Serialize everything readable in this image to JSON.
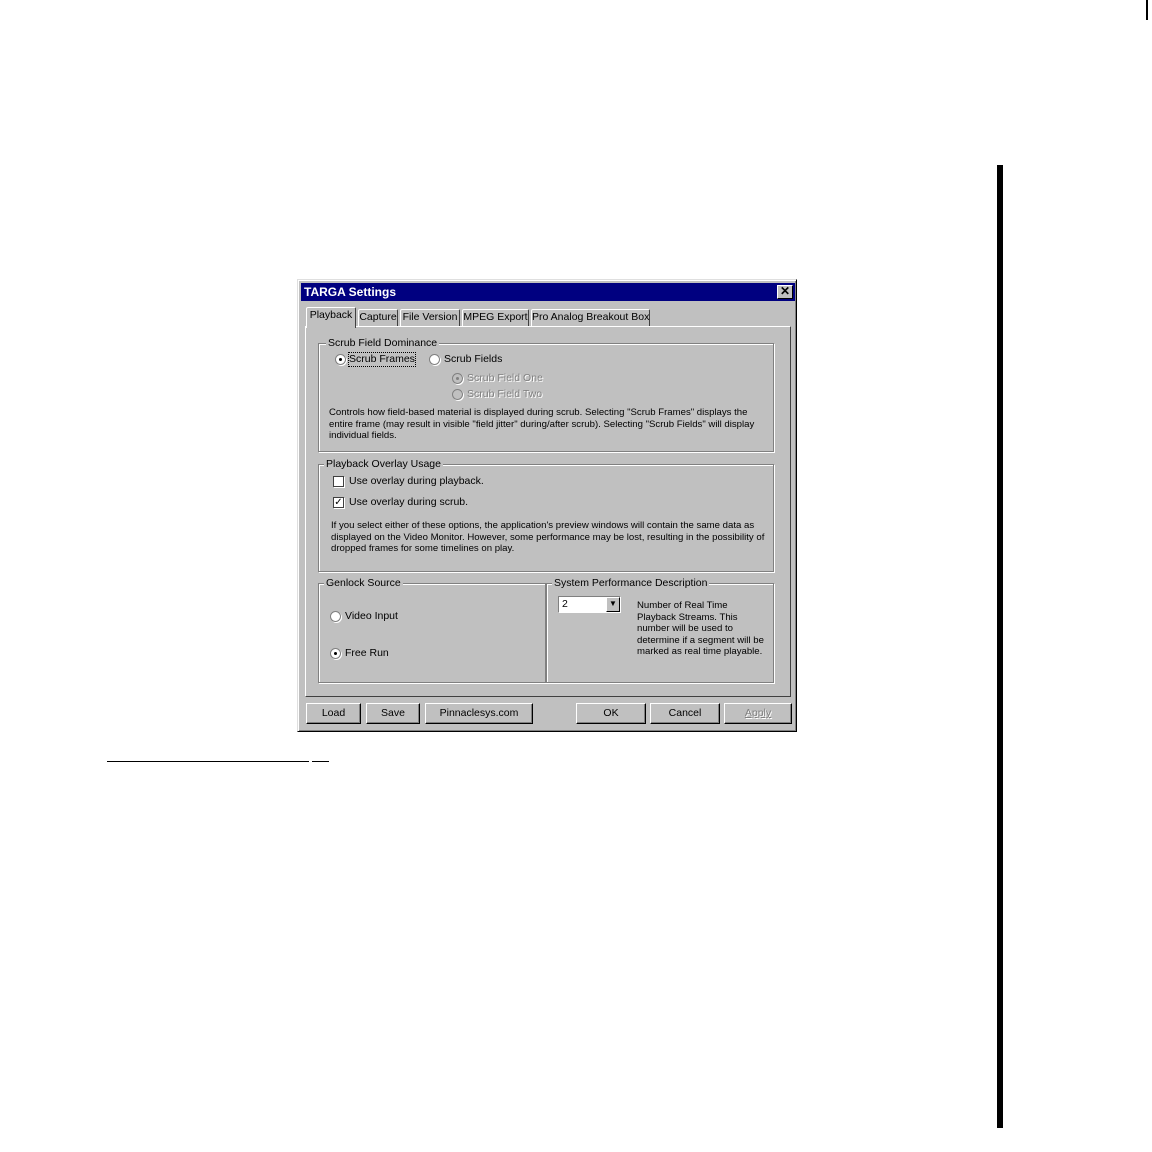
{
  "dialog": {
    "title": "TARGA Settings",
    "close_glyph": "✕"
  },
  "tabs": [
    "Playback",
    "Capture",
    "File Version",
    "MPEG Export",
    "Pro Analog Breakout Box"
  ],
  "scrub": {
    "group_title": "Scrub Field Dominance",
    "scrub_frames": "Scrub Frames",
    "scrub_fields": "Scrub Fields",
    "field_one": "Scrub Field One",
    "field_two": "Scrub Field Two",
    "selected": "Scrub Frames",
    "description": "Controls how field-based material is displayed during scrub.  Selecting \"Scrub Frames\" displays the entire frame (may result in visible \"field jitter\" during/after scrub).  Selecting \"Scrub Fields\" will display individual fields."
  },
  "overlay": {
    "group_title": "Playback Overlay Usage",
    "opt_playback": "Use overlay during playback.",
    "opt_playback_checked": false,
    "opt_scrub": "Use overlay during scrub.",
    "opt_scrub_checked": true,
    "check_glyph": "✓",
    "description": "If you select either of these options, the application's preview windows will contain the same data as displayed on the Video Monitor.  However, some performance may be lost, resulting in the possibility of dropped frames for some timelines on play."
  },
  "genlock": {
    "group_title": "Genlock Source",
    "video_input": "Video Input",
    "free_run": "Free Run",
    "selected": "Free Run"
  },
  "performance": {
    "group_title": "System Performance Description",
    "streams_value": "2",
    "dropdown_glyph": "▼",
    "description": "Number of Real Time Playback Streams.  This number will be used to determine if a segment will be marked as real time playable."
  },
  "buttons": {
    "load": "Load",
    "save": "Save",
    "pinnacle": "Pinnaclesys.com",
    "ok": "OK",
    "cancel": "Cancel",
    "apply": "Apply"
  }
}
